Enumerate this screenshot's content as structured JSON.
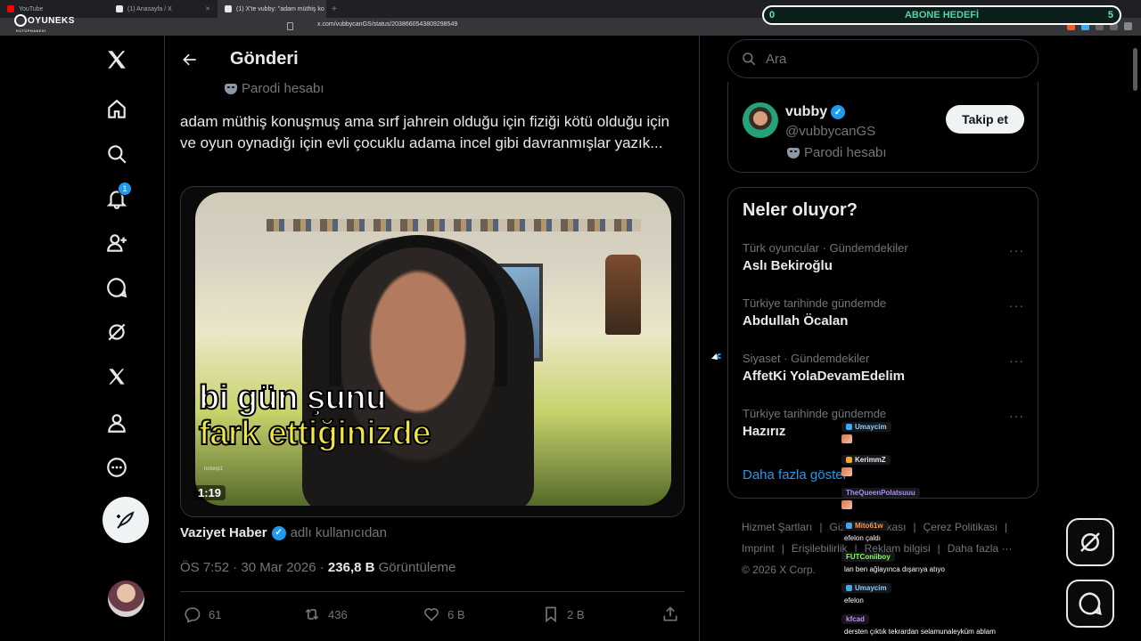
{
  "browser": {
    "tabs": [
      {
        "label": "YouTube",
        "color": "#ff0000"
      },
      {
        "label": "(1) Anasayfa / X",
        "color": "#e7e9ea"
      },
      {
        "label": "(1) X'te vubby: \"adam müthiş ko",
        "color": "#e7e9ea"
      }
    ],
    "new_tab": "+",
    "url": "x.com/vubbycanGS/status/2038660543809298549"
  },
  "overlay": {
    "logo_name": "OYUNEKS",
    "logo_sub": "KÜTÜPHANESİ",
    "goal_label": "ABONE HEDEFİ",
    "goal_current": "0",
    "goal_target": "5",
    "goal_progress": 0
  },
  "nav": {
    "notifications_badge": "1",
    "icons": [
      "x-logo-icon",
      "home-icon",
      "search-icon",
      "notifications-icon",
      "follow-icon",
      "messages-icon",
      "grok-icon",
      "premium-icon",
      "profile-icon",
      "more-icon"
    ]
  },
  "header": {
    "title": "Gönderi"
  },
  "tweet": {
    "parody_label": "Parodi hesabı",
    "text": "adam müthiş konuşmuş ama sırf jahrein olduğu için fiziği kötü olduğu için ve oyun oynadığı için evli çocuklu adama incel gibi davranmışlar yazık...",
    "caption_line1": "bi gün şunu",
    "caption_line2": "fark ettiğinizde",
    "video_watermark": "hclonp1",
    "duration": "1:19",
    "attribution_name": "Vaziyet Haber",
    "attribution_suffix": "adlı kullanıcıdan",
    "time": "ÖS 7:52 · 30 Mar 2026 · ",
    "views_value": "236,8 B",
    "views_label": "Görüntüleme",
    "replies": "61",
    "reposts": "436",
    "likes": "6 B",
    "bookmarks": "2 B"
  },
  "search": {
    "placeholder": "Ara"
  },
  "profile_card": {
    "name": "vubby",
    "handle": "@vubbycanGS",
    "parody_label": "Parodi hesabı",
    "follow_label": "Takip et"
  },
  "trends": {
    "title": "Neler oluyor?",
    "items": [
      {
        "context": "Türk oyuncular · Gündemdekiler",
        "title": "Aslı Bekiroğlu"
      },
      {
        "context": "Türkiye tarihinde gündemde",
        "title": "Abdullah Öcalan"
      },
      {
        "context": "Siyaset · Gündemdekiler",
        "title": "AffetKi YolaDevamEdelim"
      },
      {
        "context": "Türkiye tarihinde gündemde",
        "title": "Hazırız"
      }
    ],
    "more_glyph": "···",
    "show_more": "Daha fazla göster"
  },
  "footer": {
    "links": [
      "Hizmet Şartları",
      "|",
      "Gizlilik Politikası",
      "|",
      "Çerez Politikası",
      "|",
      "Imprint",
      "|",
      "Erişilebilirlik",
      "|",
      "Reklam bilgisi",
      "|",
      "Daha fazla ···"
    ],
    "copyright": "© 2026 X Corp."
  },
  "chat": {
    "messages": [
      {
        "user": "Umaycim",
        "color": "#8ad1ff",
        "text": ""
      },
      {
        "user": "KerimmZ",
        "color": "#e7e9ea",
        "text": ""
      },
      {
        "user": "TheQueenPolatsuuu",
        "color": "#b38aff",
        "text": ""
      },
      {
        "user": "Mito61w",
        "color": "#ff9a4d",
        "text": "efelon çaldı"
      },
      {
        "user": "FUTConiiboy",
        "color": "#8aff5a",
        "text": "lan ben ağlayınca dışarıya atıyo"
      },
      {
        "user": "Umaycim",
        "color": "#8ad1ff",
        "text": "efelon"
      },
      {
        "user": "kfcad",
        "color": "#c48bff",
        "text": "dersten çıktık tekrardan selamunaleyküm ablam"
      }
    ]
  }
}
